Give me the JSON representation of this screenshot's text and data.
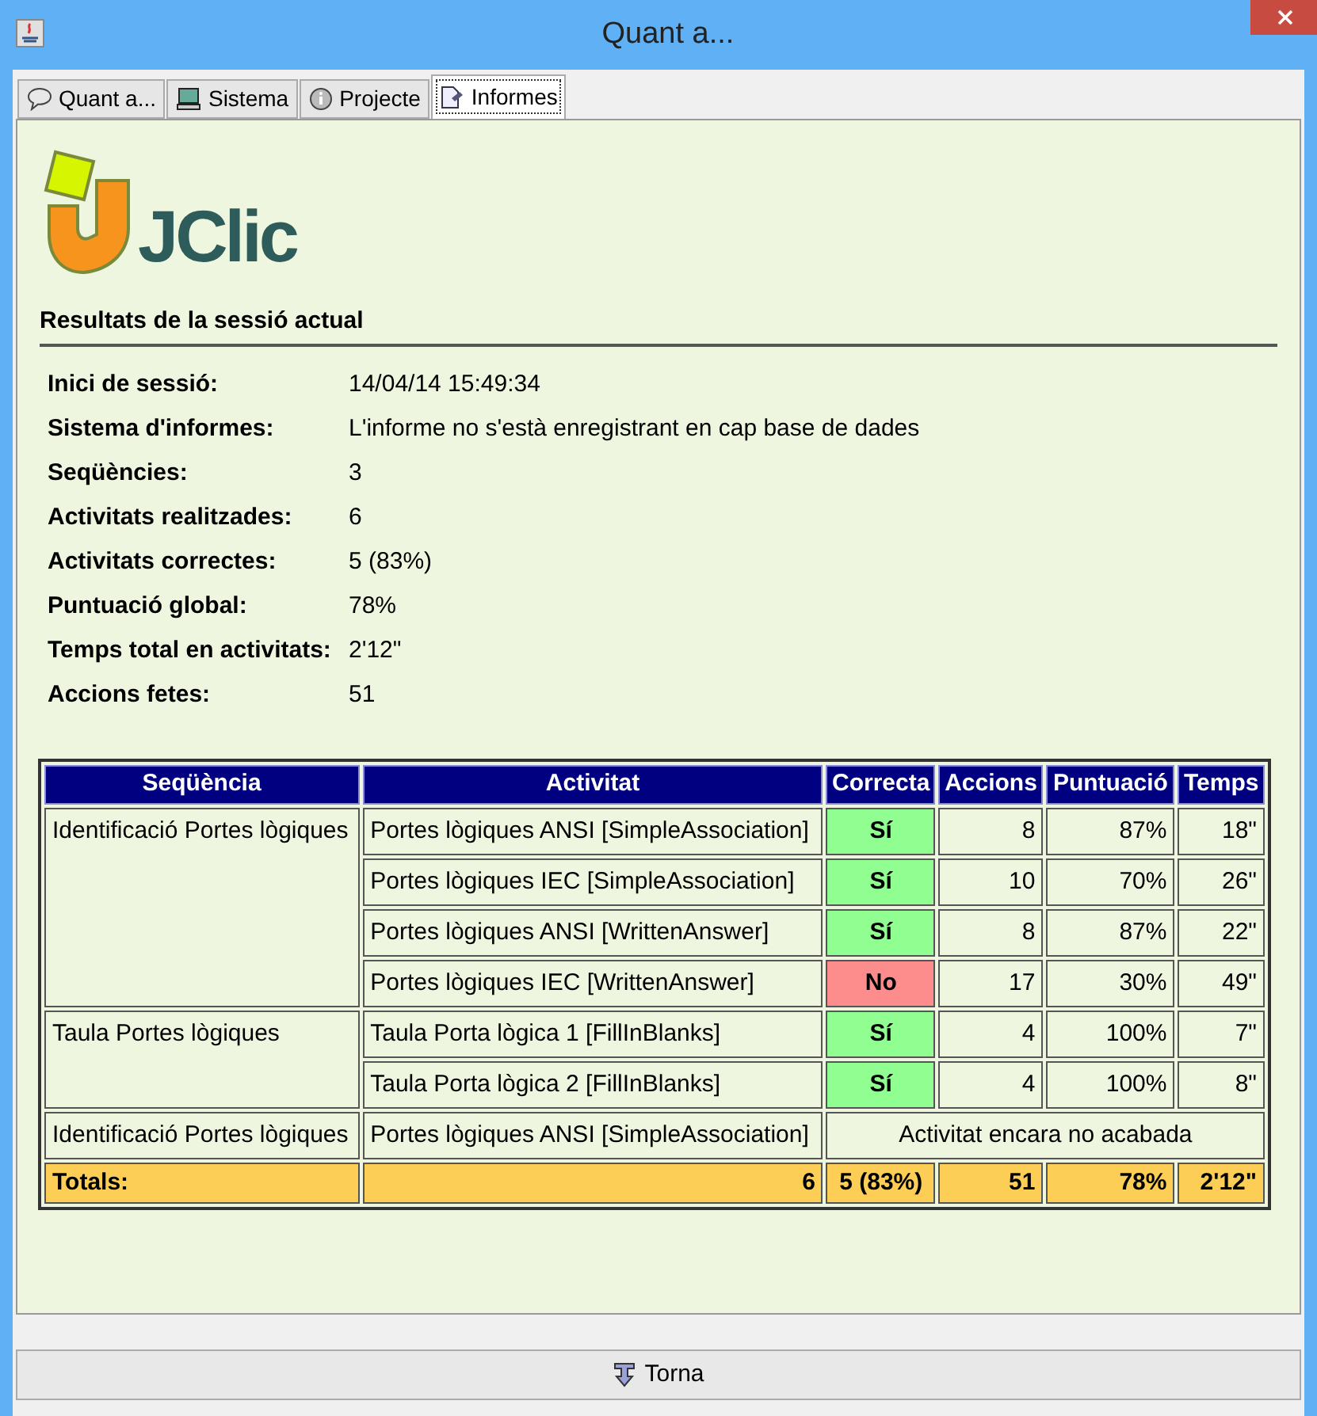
{
  "window": {
    "title": "Quant a..."
  },
  "tabs": [
    {
      "label": "Quant a...",
      "selected": false
    },
    {
      "label": "Sistema",
      "selected": false
    },
    {
      "label": "Projecte",
      "selected": false
    },
    {
      "label": "Informes",
      "selected": true
    }
  ],
  "logo": {
    "text": "JClic"
  },
  "section_title": "Resultats de la sessió actual",
  "info": [
    {
      "label": "Inici de sessió:",
      "value": "14/04/14 15:49:34"
    },
    {
      "label": "Sistema d'informes:",
      "value": "L'informe no s'està enregistrant en cap base de dades"
    },
    {
      "label": "Seqüències:",
      "value": "3"
    },
    {
      "label": "Activitats realitzades:",
      "value": "6"
    },
    {
      "label": "Activitats correctes:",
      "value": "5 (83%)"
    },
    {
      "label": "Puntuació global:",
      "value": "78%"
    },
    {
      "label": "Temps total en activitats:",
      "value": "2'12\""
    },
    {
      "label": "Accions fetes:",
      "value": "51"
    }
  ],
  "table": {
    "columns": [
      "Seqüència",
      "Activitat",
      "Correcta",
      "Accions",
      "Puntuació",
      "Temps"
    ],
    "groups": [
      {
        "sequence": "Identificació Portes lògiques",
        "rows": [
          {
            "kind": "done",
            "activity": "Portes lògiques ANSI [SimpleAssociation]",
            "correct": true,
            "result": "Sí",
            "actions": "8",
            "score": "87%",
            "time": "18\""
          },
          {
            "kind": "done",
            "activity": "Portes lògiques IEC [SimpleAssociation]",
            "correct": true,
            "result": "Sí",
            "actions": "10",
            "score": "70%",
            "time": "26\""
          },
          {
            "kind": "done",
            "activity": "Portes lògiques ANSI [WrittenAnswer]",
            "correct": true,
            "result": "Sí",
            "actions": "8",
            "score": "87%",
            "time": "22\""
          },
          {
            "kind": "done",
            "activity": "Portes lògiques IEC [WrittenAnswer]",
            "correct": false,
            "result": "No",
            "actions": "17",
            "score": "30%",
            "time": "49\""
          }
        ]
      },
      {
        "sequence": "Taula Portes lògiques",
        "rows": [
          {
            "kind": "done",
            "activity": "Taula Porta lògica 1 [FillInBlanks]",
            "correct": true,
            "result": "Sí",
            "actions": "4",
            "score": "100%",
            "time": "7\""
          },
          {
            "kind": "done",
            "activity": "Taula Porta lògica 2 [FillInBlanks]",
            "correct": true,
            "result": "Sí",
            "actions": "4",
            "score": "100%",
            "time": "8\""
          }
        ]
      },
      {
        "sequence": "Identificació Portes lògiques",
        "rows": [
          {
            "kind": "unfinished",
            "activity": "Portes lògiques ANSI [SimpleAssociation]",
            "note": "Activitat encara no acabada"
          }
        ]
      }
    ],
    "totals": {
      "label": "Totals:",
      "activities": "6",
      "correct": "5 (83%)",
      "actions": "51",
      "score": "78%",
      "time": "2'12\""
    }
  },
  "button": {
    "label": "Torna"
  }
}
